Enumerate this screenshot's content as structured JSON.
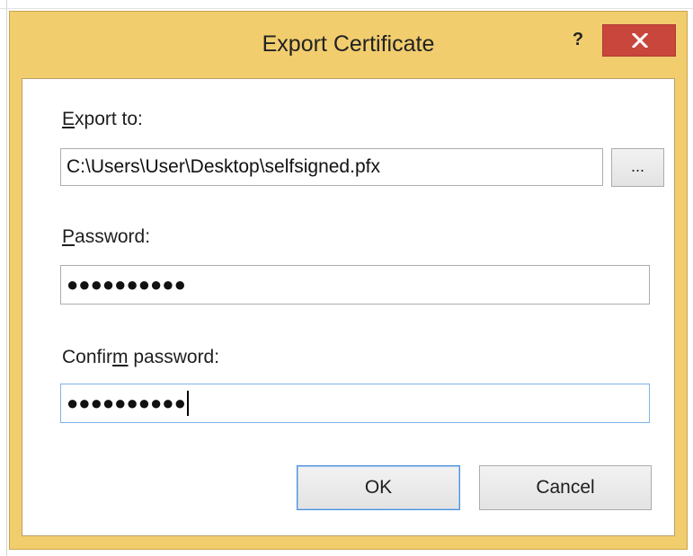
{
  "window": {
    "title": "Export Certificate",
    "help_label": "?",
    "colors": {
      "frame": "#f1cd6e",
      "close_button": "#c9463d",
      "focus_border": "#7eb4ea"
    }
  },
  "form": {
    "export_to": {
      "label_accel": "E",
      "label_rest": "xport to:",
      "value": "C:\\Users\\User\\Desktop\\selfsigned.pfx",
      "browse_label": "..."
    },
    "password": {
      "label_accel": "P",
      "label_rest": "assword:",
      "masked_value": "●●●●●●●●●●"
    },
    "confirm_password": {
      "label_pre": "Confir",
      "label_accel": "m",
      "label_rest": " password:",
      "masked_value": "●●●●●●●●●●"
    }
  },
  "buttons": {
    "ok": "OK",
    "cancel": "Cancel"
  },
  "icons": {
    "close": "close-icon"
  }
}
